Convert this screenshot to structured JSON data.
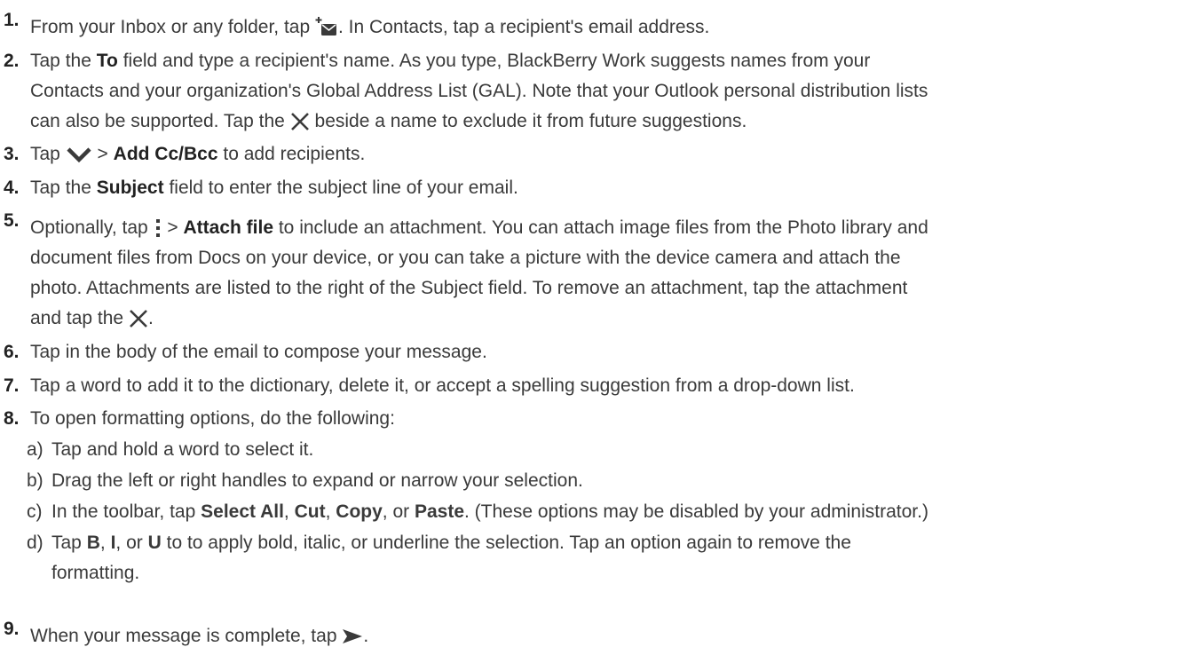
{
  "steps": [
    {
      "num": "1.",
      "a": "From your Inbox or any folder, tap",
      "b": ". In Contacts, tap a recipient's email address."
    },
    {
      "num": "2.",
      "a": "Tap the",
      "b_bold": "To",
      "c": "field and type a recipient's name. As you type, BlackBerry Work suggests names from your",
      "line2": "Contacts and your organization's Global Address List (GAL). Note that your Outlook personal distribution lists",
      "line3a": "can also be supported. Tap the",
      "line3b": "beside a name to exclude it from future suggestions."
    },
    {
      "num": "3.",
      "a": "Tap",
      "b": ">",
      "c_bold": "Add Cc/Bcc",
      "d": "to add recipients."
    },
    {
      "num": "4.",
      "a": "Tap the",
      "b_bold": "Subject",
      "c": "field to enter the subject line of your email."
    },
    {
      "num": "5.",
      "a": "Optionally, tap",
      "b": ">",
      "c_bold": "Attach file",
      "d": "to include an attachment. You can attach image files from the Photo library and",
      "line2": "document files from Docs on your device, or you can take a picture with the device camera and attach the",
      "line3": "photo. Attachments are listed to the right of the Subject field. To remove an attachment, tap the attachment",
      "line4a": "and tap the",
      "line4b": "."
    },
    {
      "num": "6.",
      "a": "Tap in the body of the email to compose your message."
    },
    {
      "num": "7.",
      "a": "Tap a word to add it to the dictionary, delete it, or accept a spelling suggestion from a drop-down list."
    },
    {
      "num": "8.",
      "a": "To open formatting options, do the following:",
      "subs": [
        {
          "letter": "a)",
          "text": "Tap and hold a word to select it."
        },
        {
          "letter": "b)",
          "text": "Drag the left or right handles to expand or narrow your selection."
        },
        {
          "letter": "c)",
          "t1": "In the toolbar, tap",
          "b1": "Select All",
          "t2": ",",
          "b2": "Cut",
          "t3": ",",
          "b3": "Copy",
          "t4": ", or",
          "b4": "Paste",
          "t5": ". (These options may be disabled by your administrator.)"
        },
        {
          "letter": "d)",
          "t1": "Tap",
          "b1": "B",
          "t2": ",",
          "b2": "I",
          "t3": ", or",
          "b3": "U",
          "t4": "to to apply bold, italic, or underline the selection. Tap an option again to remove the",
          "line2": "formatting."
        }
      ]
    },
    {
      "num": "9.",
      "a": "When your message is complete, tap",
      "b": "."
    }
  ],
  "icons": {
    "compose": "compose-email-icon",
    "close": "close-x-icon",
    "chevron": "chevron-down-icon",
    "more": "more-vertical-icon",
    "send": "send-icon"
  },
  "colors": {
    "text": "#3a3a3a",
    "icon": "#3a3a3a"
  }
}
